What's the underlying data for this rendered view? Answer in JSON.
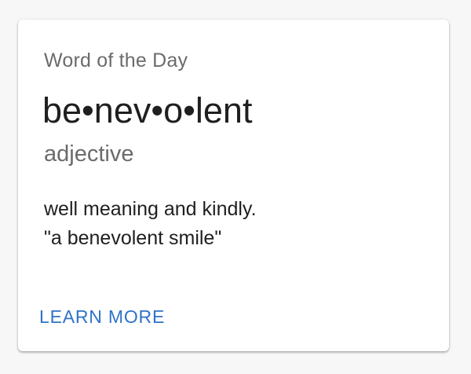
{
  "card": {
    "overline": "Word of the Day",
    "word": "be•nev•o•lent",
    "part_of_speech": "adjective",
    "definition": "well meaning and kindly.",
    "example": "\"a benevolent smile\"",
    "action_label": "LEARN MORE"
  },
  "colors": {
    "accent": "#2f73c8",
    "text_primary": "#1f1f1f",
    "text_secondary": "#6b6b6b",
    "card_background": "#ffffff",
    "page_background": "#f7f7f7"
  }
}
